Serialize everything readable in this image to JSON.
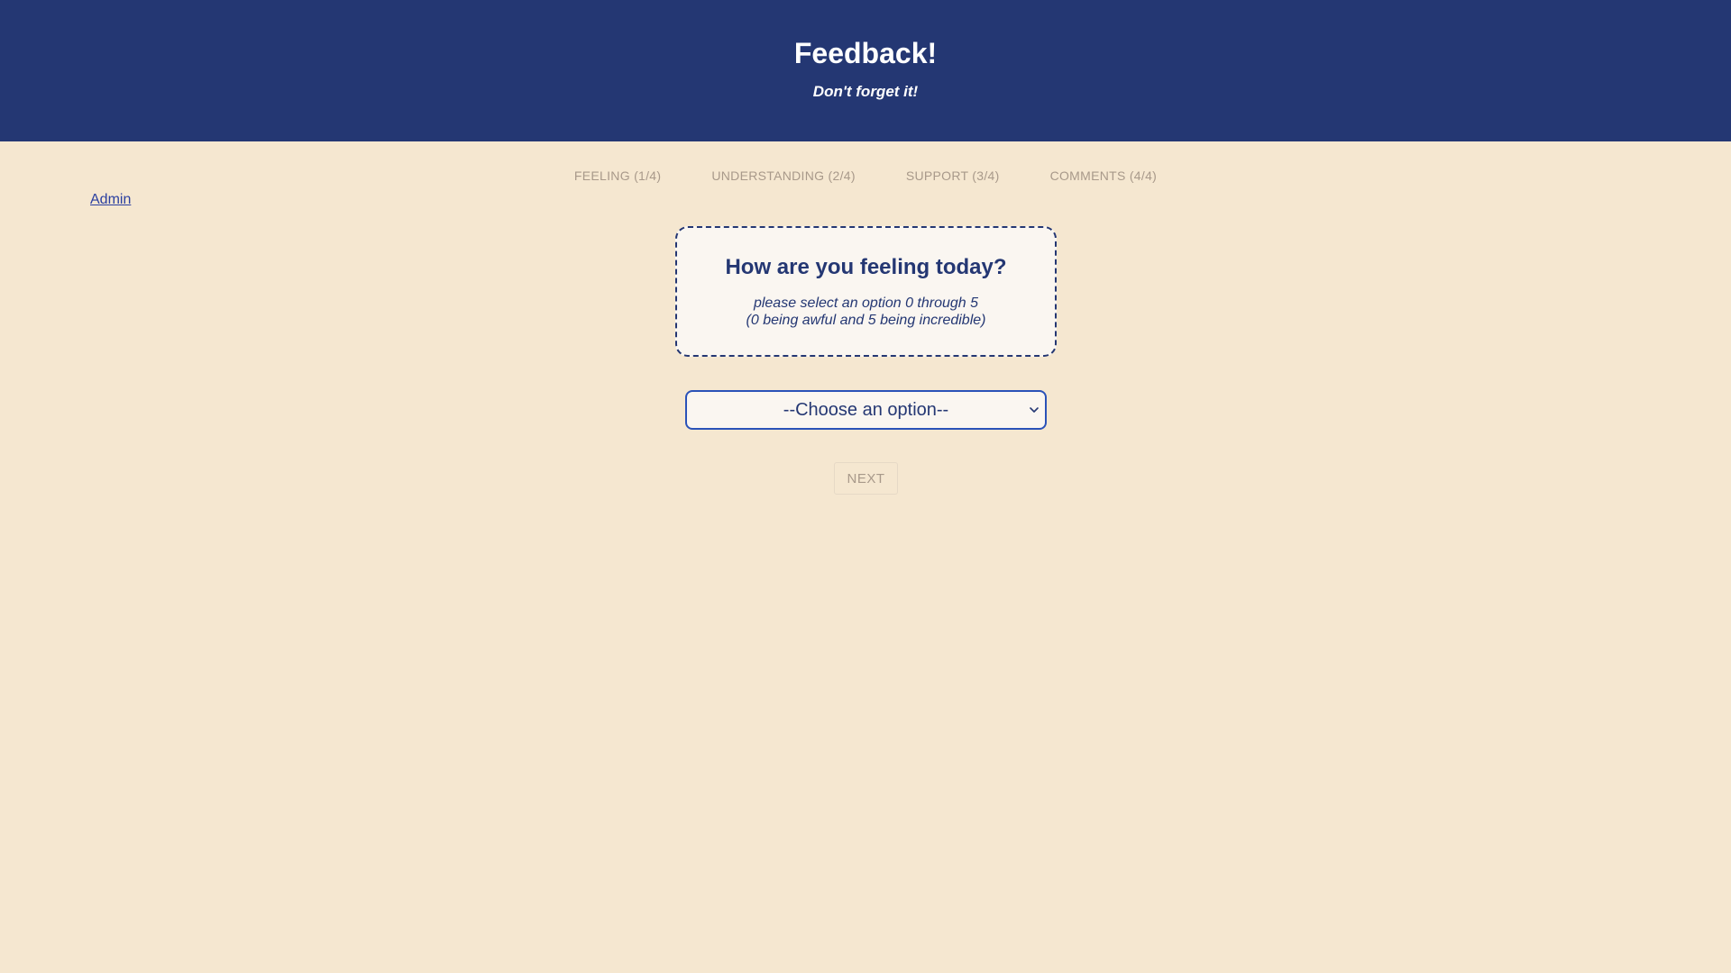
{
  "header": {
    "title": "Feedback!",
    "subtitle": "Don't forget it!"
  },
  "steps": [
    {
      "label": "FEELING (1/4)"
    },
    {
      "label": "UNDERSTANDING (2/4)"
    },
    {
      "label": "SUPPORT (3/4)"
    },
    {
      "label": "COMMENTS (4/4)"
    }
  ],
  "admin_link": "Admin",
  "question": {
    "title": "How are you feeling today?",
    "hint_line1": "please select an option 0 through 5",
    "hint_line2": "(0 being awful and 5 being incredible)"
  },
  "select": {
    "value": "--Choose an option--",
    "chevron_icon": "chevron-down-icon"
  },
  "next_button": {
    "label": "NEXT",
    "disabled": true
  },
  "colors": {
    "header_bg": "#243773",
    "page_bg": "#f5e7d0",
    "accent": "#243773",
    "select_border": "#2a52b8",
    "muted": "#a8998a"
  }
}
